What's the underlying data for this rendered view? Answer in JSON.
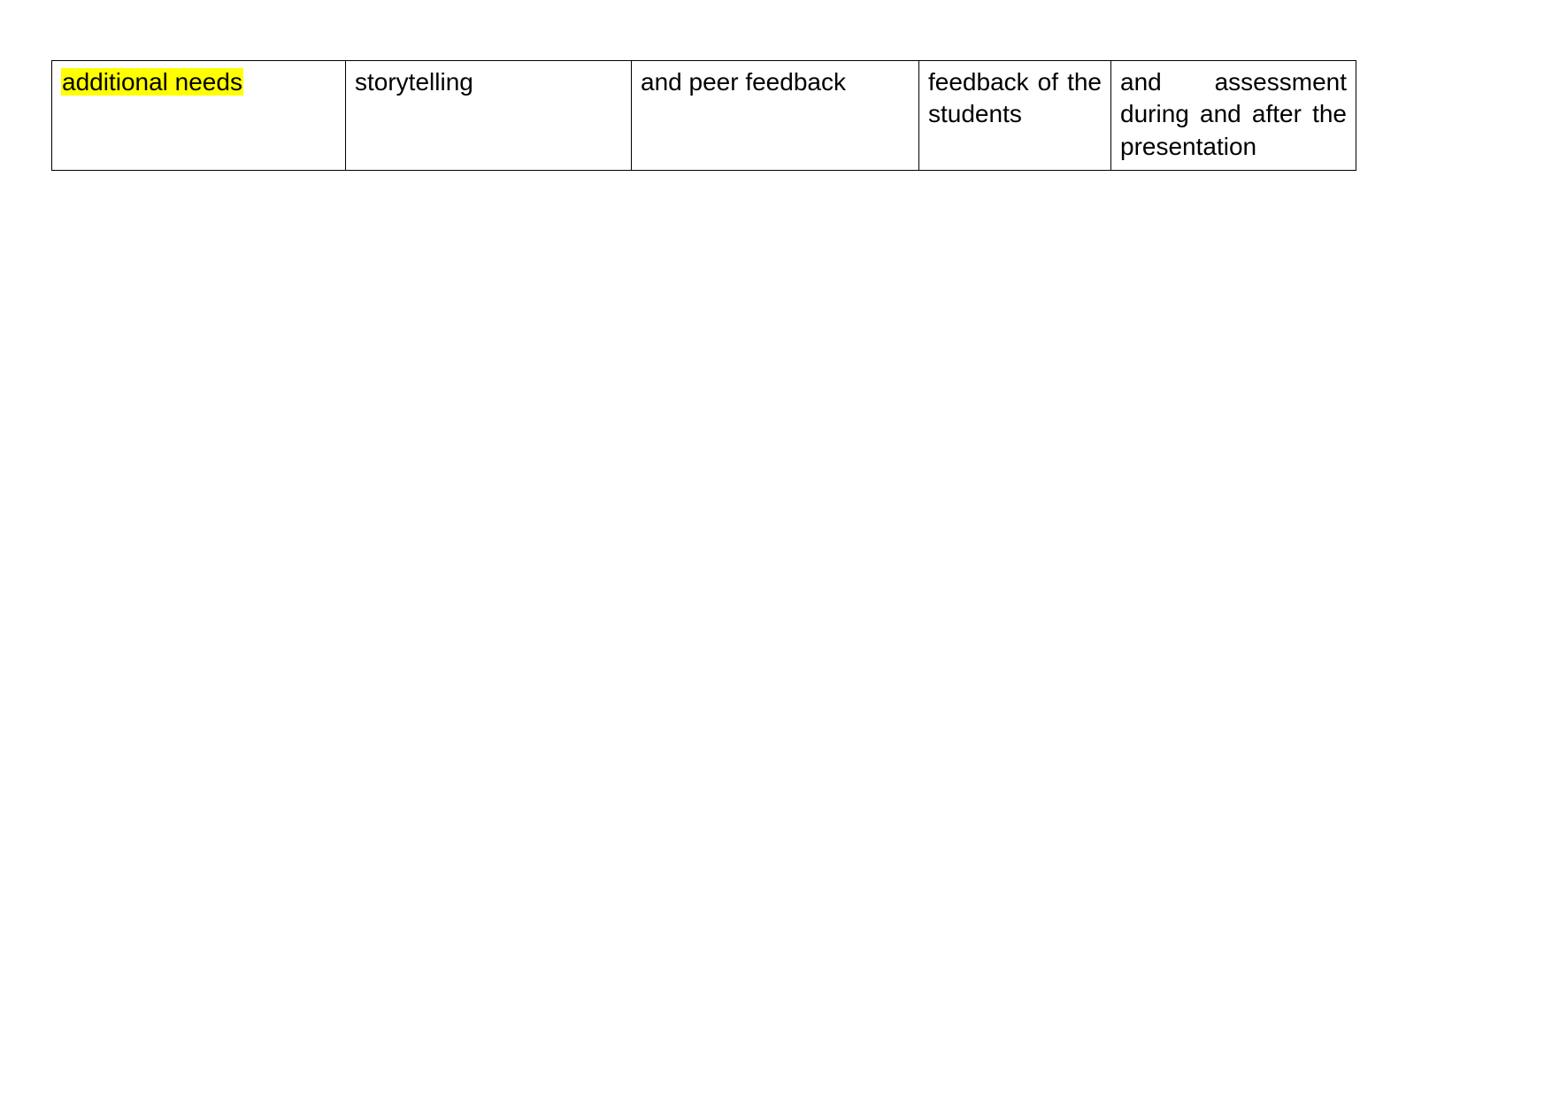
{
  "document": {
    "background_color": "#ffffff",
    "text_color": "#000000",
    "highlight_color": "#ffff00"
  },
  "table": {
    "rows": 1,
    "columns": 5,
    "border_color": "#000000",
    "cells": [
      {
        "id": "cell-1",
        "text": "additional needs",
        "highlighted": true,
        "align": "left"
      },
      {
        "id": "cell-2",
        "text": "storytelling",
        "highlighted": false,
        "align": "left"
      },
      {
        "id": "cell-3",
        "text": "and peer feedback",
        "highlighted": false,
        "align": "left"
      },
      {
        "id": "cell-4",
        "text": "feedback of the students",
        "highlighted": false,
        "align": "justify"
      },
      {
        "id": "cell-5",
        "text": "and assessment during and after the presentation",
        "highlighted": false,
        "align": "justify"
      }
    ]
  }
}
